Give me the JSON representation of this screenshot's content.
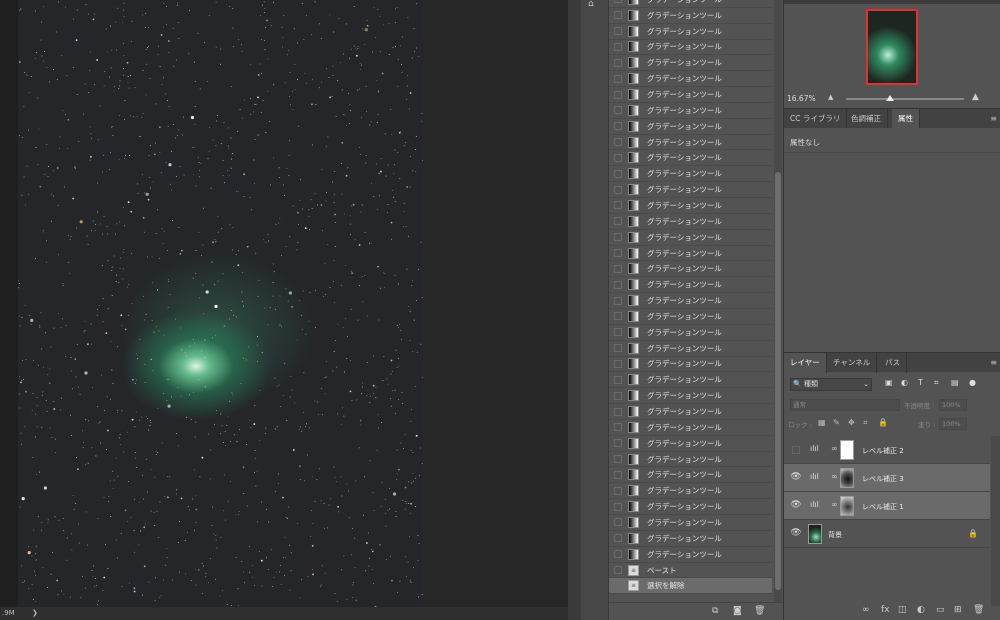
{
  "status": {
    "size": ".9M",
    "chevron": "❯"
  },
  "history": {
    "items": [
      {
        "label": "グラデーションツール",
        "type": "gradient"
      },
      {
        "label": "グラデーションツール",
        "type": "gradient"
      },
      {
        "label": "グラデーションツール",
        "type": "gradient"
      },
      {
        "label": "グラデーションツール",
        "type": "gradient"
      },
      {
        "label": "グラデーションツール",
        "type": "gradient"
      },
      {
        "label": "グラデーションツール",
        "type": "gradient"
      },
      {
        "label": "グラデーションツール",
        "type": "gradient"
      },
      {
        "label": "グラデーションツール",
        "type": "gradient"
      },
      {
        "label": "グラデーションツール",
        "type": "gradient"
      },
      {
        "label": "グラデーションツール",
        "type": "gradient"
      },
      {
        "label": "グラデーションツール",
        "type": "gradient"
      },
      {
        "label": "グラデーションツール",
        "type": "gradient"
      },
      {
        "label": "グラデーションツール",
        "type": "gradient"
      },
      {
        "label": "グラデーションツール",
        "type": "gradient"
      },
      {
        "label": "グラデーションツール",
        "type": "gradient"
      },
      {
        "label": "グラデーションツール",
        "type": "gradient"
      },
      {
        "label": "グラデーションツール",
        "type": "gradient"
      },
      {
        "label": "グラデーションツール",
        "type": "gradient"
      },
      {
        "label": "グラデーションツール",
        "type": "gradient"
      },
      {
        "label": "グラデーションツール",
        "type": "gradient"
      },
      {
        "label": "グラデーションツール",
        "type": "gradient"
      },
      {
        "label": "グラデーションツール",
        "type": "gradient"
      },
      {
        "label": "グラデーションツール",
        "type": "gradient"
      },
      {
        "label": "グラデーションツール",
        "type": "gradient"
      },
      {
        "label": "グラデーションツール",
        "type": "gradient"
      },
      {
        "label": "グラデーションツール",
        "type": "gradient"
      },
      {
        "label": "グラデーションツール",
        "type": "gradient"
      },
      {
        "label": "グラデーションツール",
        "type": "gradient"
      },
      {
        "label": "グラデーションツール",
        "type": "gradient"
      },
      {
        "label": "グラデーションツール",
        "type": "gradient"
      },
      {
        "label": "グラデーションツール",
        "type": "gradient"
      },
      {
        "label": "グラデーションツール",
        "type": "gradient"
      },
      {
        "label": "グラデーションツール",
        "type": "gradient"
      },
      {
        "label": "グラデーションツール",
        "type": "gradient"
      },
      {
        "label": "グラデーションツール",
        "type": "gradient"
      },
      {
        "label": "グラデーションツール",
        "type": "gradient"
      },
      {
        "label": "ペースト",
        "type": "doc"
      },
      {
        "label": "選択を解除",
        "type": "doc",
        "selected": true
      }
    ],
    "footer_icons": [
      "new-snapshot-from-state-icon",
      "camera-icon",
      "trash-icon"
    ]
  },
  "navigator": {
    "zoom": "16.67%"
  },
  "properties": {
    "tabs": [
      {
        "label": "CC ライブラリ"
      },
      {
        "label": "色調補正"
      },
      {
        "label": "属性",
        "active": true
      }
    ],
    "body_text": "属性なし",
    "menu": "≡"
  },
  "layers": {
    "tabs": [
      {
        "label": "レイヤー",
        "active": true
      },
      {
        "label": "チャンネル"
      },
      {
        "label": "パス"
      }
    ],
    "kind_label": "種類",
    "kind_prefix": "🔍",
    "kind_chevron": "⌄",
    "blend_mode": "通常",
    "opacity_label": "不透明度 :",
    "opacity_value": "100%",
    "lock_label": "ロック :",
    "fill_label": "塗り :",
    "fill_value": "100%",
    "menu": "≡",
    "items": [
      {
        "name": "レベル補正 2",
        "visible": false,
        "kind": "adjustment",
        "mask": "white"
      },
      {
        "name": "レベル補正 3",
        "visible": true,
        "kind": "adjustment",
        "mask": "dark",
        "selected": true
      },
      {
        "name": "レベル補正 1",
        "visible": true,
        "kind": "adjustment",
        "mask": "mid",
        "selected": true
      },
      {
        "name": "背景",
        "visible": true,
        "kind": "background",
        "locked": true
      }
    ]
  },
  "colors": {
    "accent_red": "#e03030",
    "panel": "#535353",
    "dark": "#282828"
  }
}
